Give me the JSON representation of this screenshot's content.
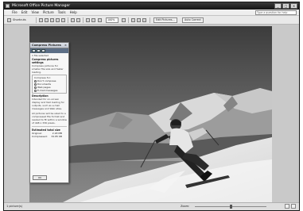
{
  "window": {
    "title": "Microsoft Office Picture Manager",
    "controls": [
      "_",
      "□",
      "×"
    ]
  },
  "menu": {
    "items": [
      "File",
      "Edit",
      "View",
      "Picture",
      "Tools",
      "Help"
    ],
    "help_placeholder": "Type a question for help"
  },
  "toolbar": {
    "shortcuts_label": "Shortcuts",
    "zoom_value": "100%",
    "edit_pictures_label": "Edit Pictures...",
    "auto_correct_label": "Auto Correct"
  },
  "panel": {
    "title": "Compress Pictures",
    "selection_count": "1 file selected",
    "settings_heading": "Compress pictures settings",
    "settings_desc": "Compress pictures for smaller file size and faster loading.",
    "compress_for_label": "Compress for:",
    "options": [
      {
        "label": "Don't compress",
        "selected": false
      },
      {
        "label": "Documents",
        "selected": false
      },
      {
        "label": "Web pages",
        "selected": false
      },
      {
        "label": "E-mail messages",
        "selected": true
      }
    ],
    "description_heading": "Description",
    "description_1": "Intended for on-screen display and fast loading for outputs, such as e-mail messages and Web sites.",
    "description_2": "All pictures will be sized to a compressed file format and resized to fit within a window of 448 x 336 pixels.",
    "estimated_heading": "Estimated total size",
    "original_label": "Original:",
    "original_value": "2.18 MB",
    "compressed_label": "Compressed:",
    "compressed_value": "32.85 KB",
    "ok_label": "OK"
  },
  "status": {
    "left": "1 picture(s)",
    "zoom_label": "Zoom:"
  }
}
